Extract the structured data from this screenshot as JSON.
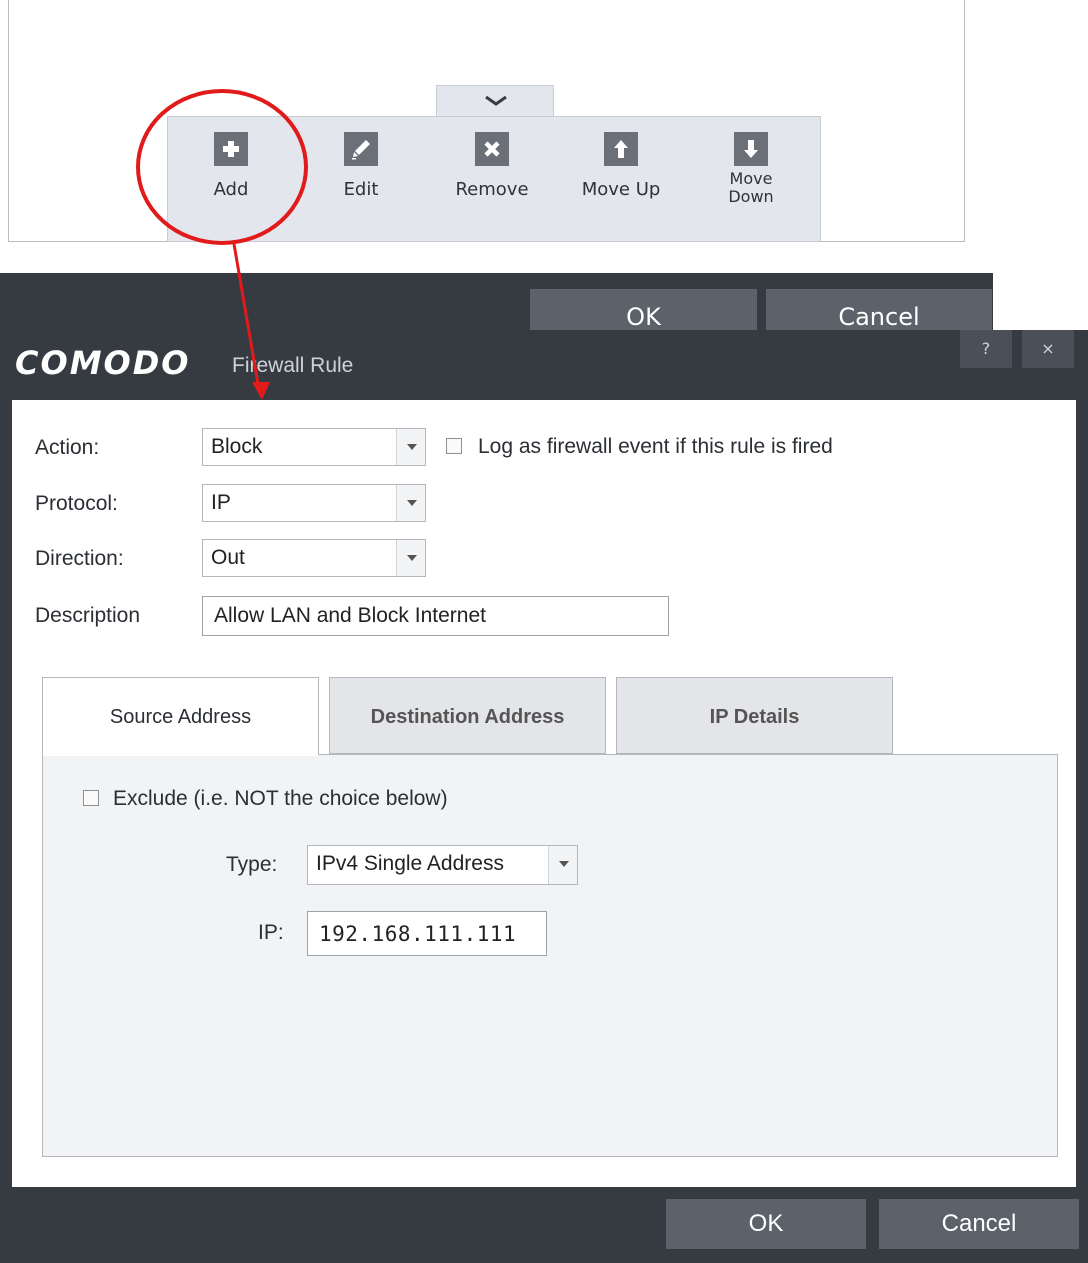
{
  "toolbar": {
    "items": [
      {
        "label": "Add",
        "icon": "plus-icon"
      },
      {
        "label": "Edit",
        "icon": "pencil-icon"
      },
      {
        "label": "Remove",
        "icon": "x-icon"
      },
      {
        "label": "Move Up",
        "icon": "arrow-up-icon"
      },
      {
        "label_line1": "Move",
        "label_line2": "Down",
        "icon": "arrow-down-icon"
      }
    ],
    "collapse_icon": "chevron-down-icon"
  },
  "annotation": {
    "color": "#e11b1b"
  },
  "background_window": {
    "ok_label": "OK",
    "cancel_label": "Cancel"
  },
  "dialog": {
    "logo": "COMODO",
    "title": "Firewall Rule",
    "help_label": "?",
    "close_label": "×",
    "action": {
      "label": "Action:",
      "value": "Block"
    },
    "log_checkbox": {
      "label": "Log as firewall event if this rule is fired",
      "checked": false
    },
    "protocol": {
      "label": "Protocol:",
      "value": "IP"
    },
    "direction": {
      "label": "Direction:",
      "value": "Out"
    },
    "description": {
      "label": "Description",
      "value": "Allow LAN and Block Internet"
    },
    "tabs": [
      {
        "label": "Source Address",
        "active": true
      },
      {
        "label": "Destination Address",
        "active": false
      },
      {
        "label": "IP Details",
        "active": false
      }
    ],
    "source": {
      "exclude_label": "Exclude (i.e. NOT the choice below)",
      "exclude_checked": false,
      "type_label": "Type:",
      "type_value": "IPv4 Single Address",
      "ip_label": "IP:",
      "ip_value": "192.168.111.111"
    },
    "ok_label": "OK",
    "cancel_label": "Cancel"
  },
  "colors": {
    "dark_bg": "#363b42",
    "button_bg": "#5c626a",
    "toolbar_bg": "#e3e6ec",
    "icon_bg": "#6b7078"
  }
}
